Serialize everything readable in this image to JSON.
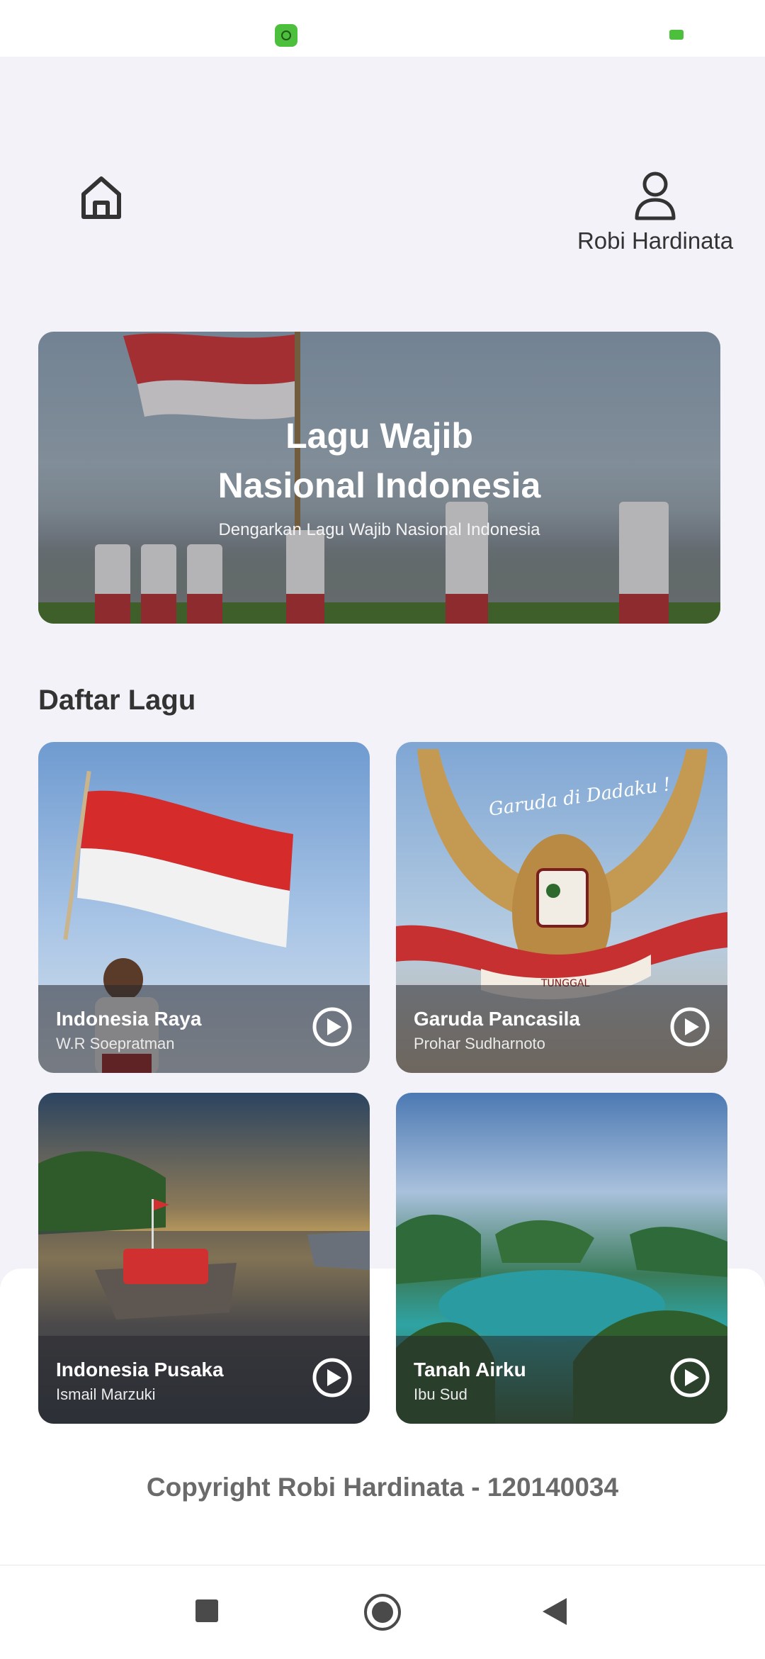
{
  "header": {
    "home_icon": "home-icon",
    "profile_icon": "user-icon",
    "profile_name": "Robi Hardinata"
  },
  "hero": {
    "title_line1": "Lagu Wajib",
    "title_line2": "Nasional Indonesia",
    "subtitle": "Dengarkan Lagu Wajib Nasional Indonesia"
  },
  "songs_section": {
    "title": "Daftar Lagu",
    "items": [
      {
        "title": "Indonesia Raya",
        "artist": "W.R Soepratman"
      },
      {
        "title": "Garuda Pancasila",
        "artist": "Prohar Sudharnoto"
      },
      {
        "title": "Indonesia Pusaka",
        "artist": "Ismail Marzuki"
      },
      {
        "title": "Tanah Airku",
        "artist": "Ibu Sud"
      }
    ]
  },
  "garuda_card": {
    "caption": "Garuda di Dadaku !",
    "banner": "TUNGGAL"
  },
  "footer": {
    "copyright": "Copyright Robi Hardinata - 120140034"
  },
  "colors": {
    "background": "#f3f2f8",
    "accent_status": "#4cbf3c",
    "text": "#333333"
  }
}
